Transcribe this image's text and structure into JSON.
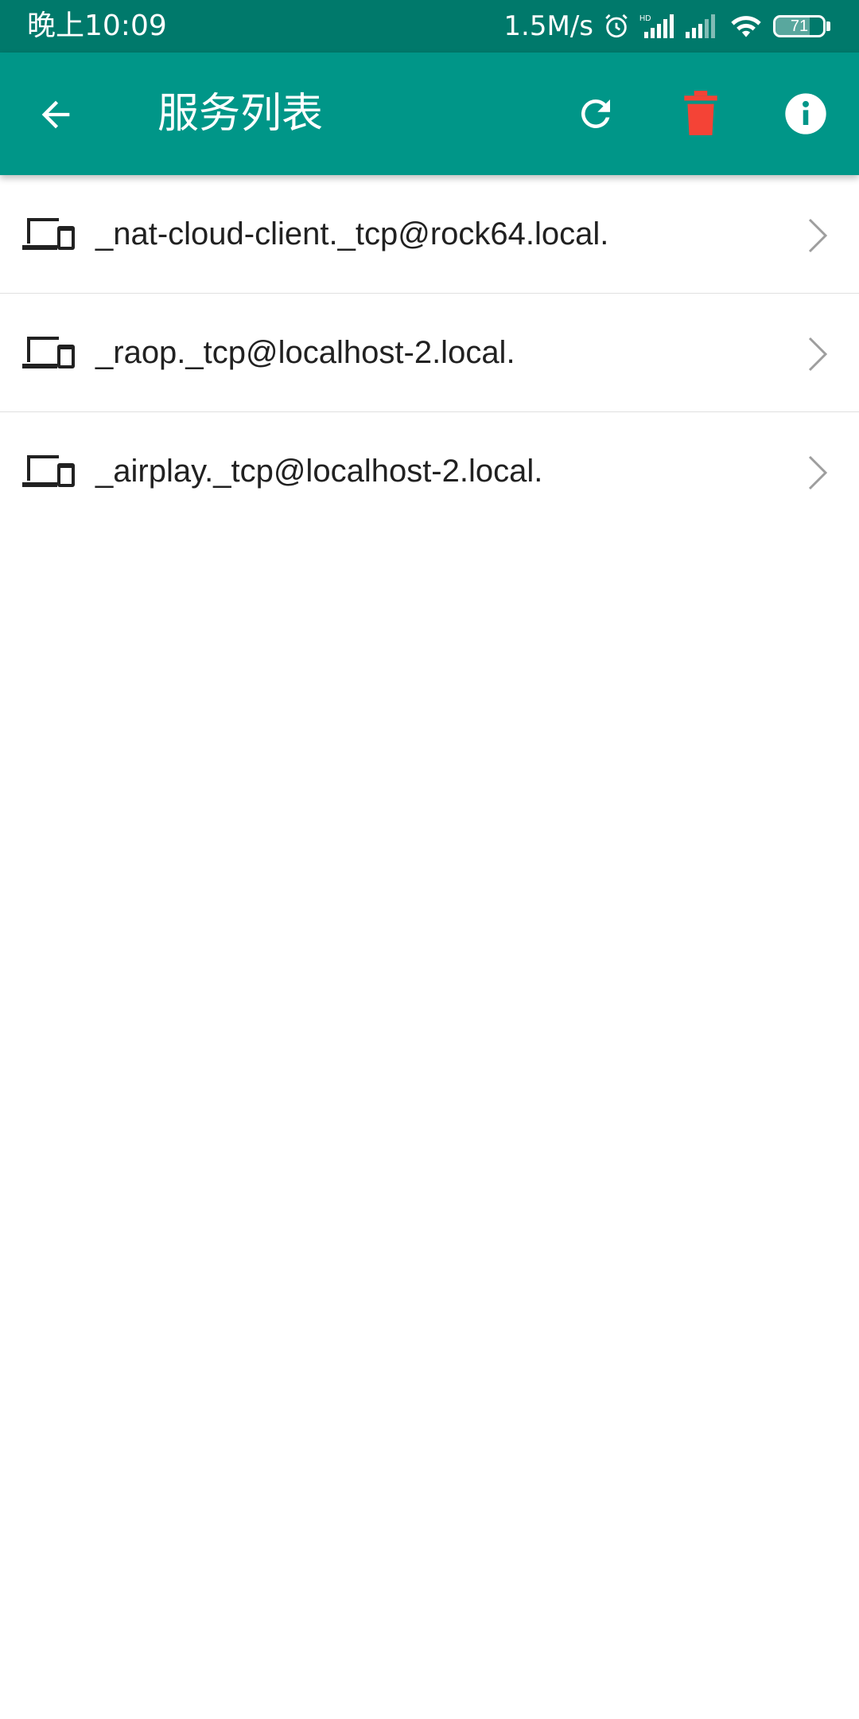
{
  "status_bar": {
    "time": "晚上10:09",
    "net_speed": "1.5M/s",
    "battery_level": "71",
    "battery_fraction": 0.71
  },
  "app_bar": {
    "title": "服务列表",
    "icons": {
      "back": "back-arrow-icon",
      "refresh": "refresh-icon",
      "delete": "trash-icon",
      "info": "info-icon"
    },
    "colors": {
      "primary": "#009688",
      "status": "#00796b",
      "delete": "#f44336"
    }
  },
  "services": {
    "items": [
      {
        "name": "_nat-cloud-client._tcp@rock64.local.",
        "icon": "devices-icon"
      },
      {
        "name": "_raop._tcp@localhost-2.local.",
        "icon": "devices-icon"
      },
      {
        "name": "_airplay._tcp@localhost-2.local.",
        "icon": "devices-icon"
      }
    ]
  }
}
